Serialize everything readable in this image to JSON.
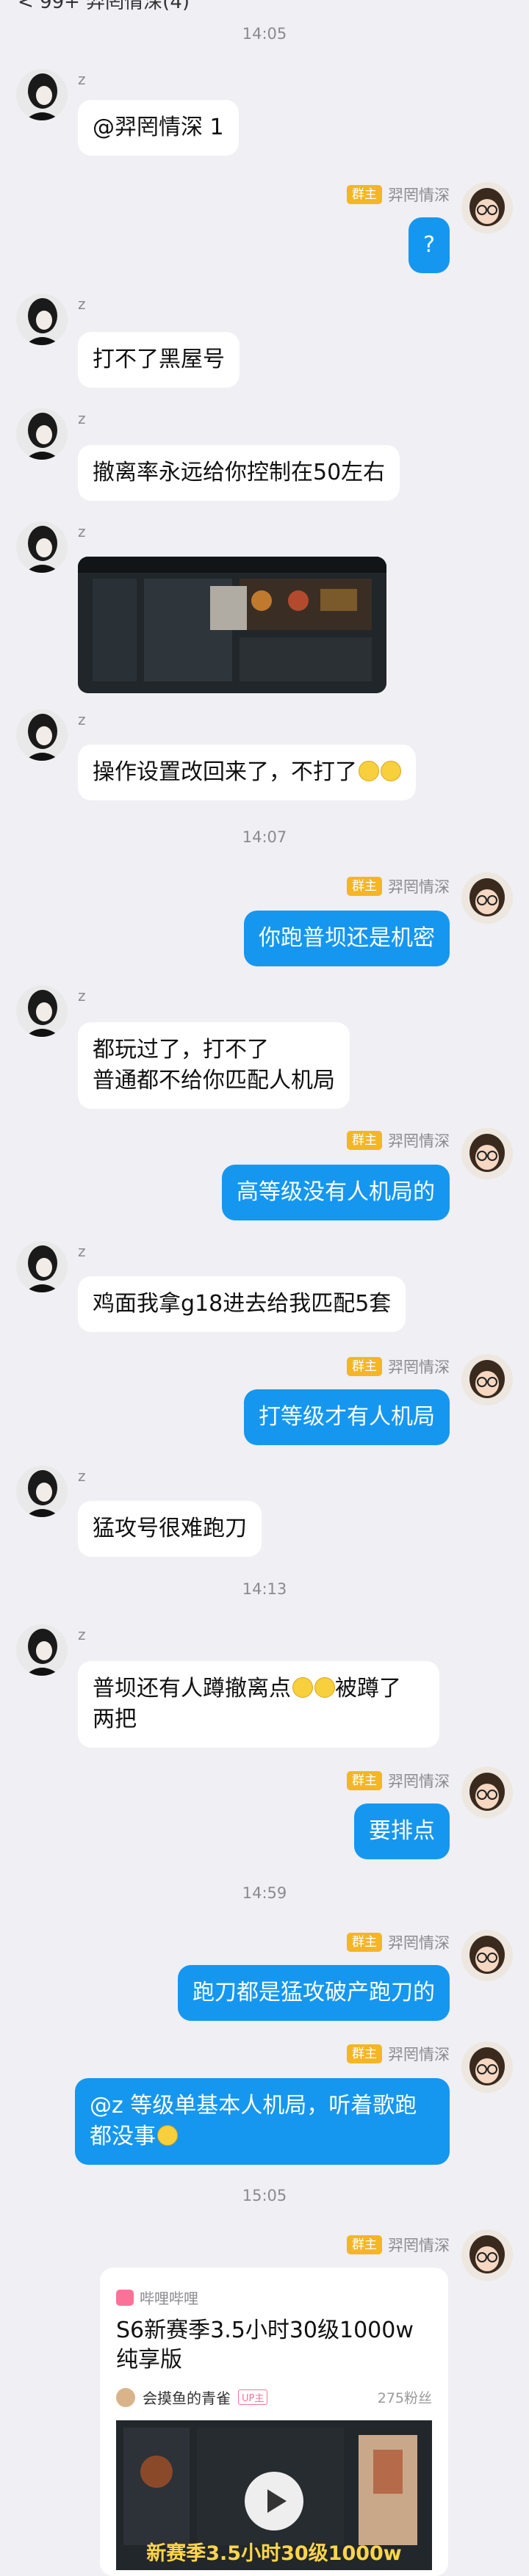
{
  "header": {
    "title": "< 99+ 羿罔情深(4)"
  },
  "times": [
    "14:05",
    "14:07",
    "14:13",
    "14:59",
    "15:05"
  ],
  "users": {
    "z": {
      "name": "z"
    },
    "me": {
      "name": "羿罔情深",
      "badge": "群主"
    }
  },
  "messages": [
    {
      "text": "@羿罔情深 1"
    },
    {
      "text": "?"
    },
    {
      "text": "打不了黑屋号"
    },
    {
      "text": "撤离率永远给你控制在50左右"
    },
    {
      "text": "操作设置改回来了，不打了"
    },
    {
      "text": "你跑普坝还是机密"
    },
    {
      "text": "都玩过了，打不了\n普通都不给你匹配人机局"
    },
    {
      "text": "高等级没有人机局的"
    },
    {
      "text": "鸡面我拿g18进去给我匹配5套"
    },
    {
      "text": "打等级才有人机局"
    },
    {
      "text": "猛攻号很难跑刀"
    },
    {
      "text": "普坝还有人蹲撤离点"
    },
    {
      "text": "被蹲了\n两把"
    },
    {
      "text": "要排点"
    },
    {
      "text": "跑刀都是猛攻破产跑刀的"
    },
    {
      "text": "@z 等级单基本人机局，听着歌跑\n都没事"
    }
  ],
  "share_card": {
    "source": "哔哩哔哩",
    "title": "S6新赛季3.5小时30级1000w纯享版",
    "uploader": "会摸鱼的青雀",
    "uploader_tag": "UP主",
    "fans": "275粉丝",
    "cover_text": "新赛季3.5小时30级1000w"
  },
  "icons": {
    "play": "play-icon",
    "source": "bilibili-icon"
  }
}
